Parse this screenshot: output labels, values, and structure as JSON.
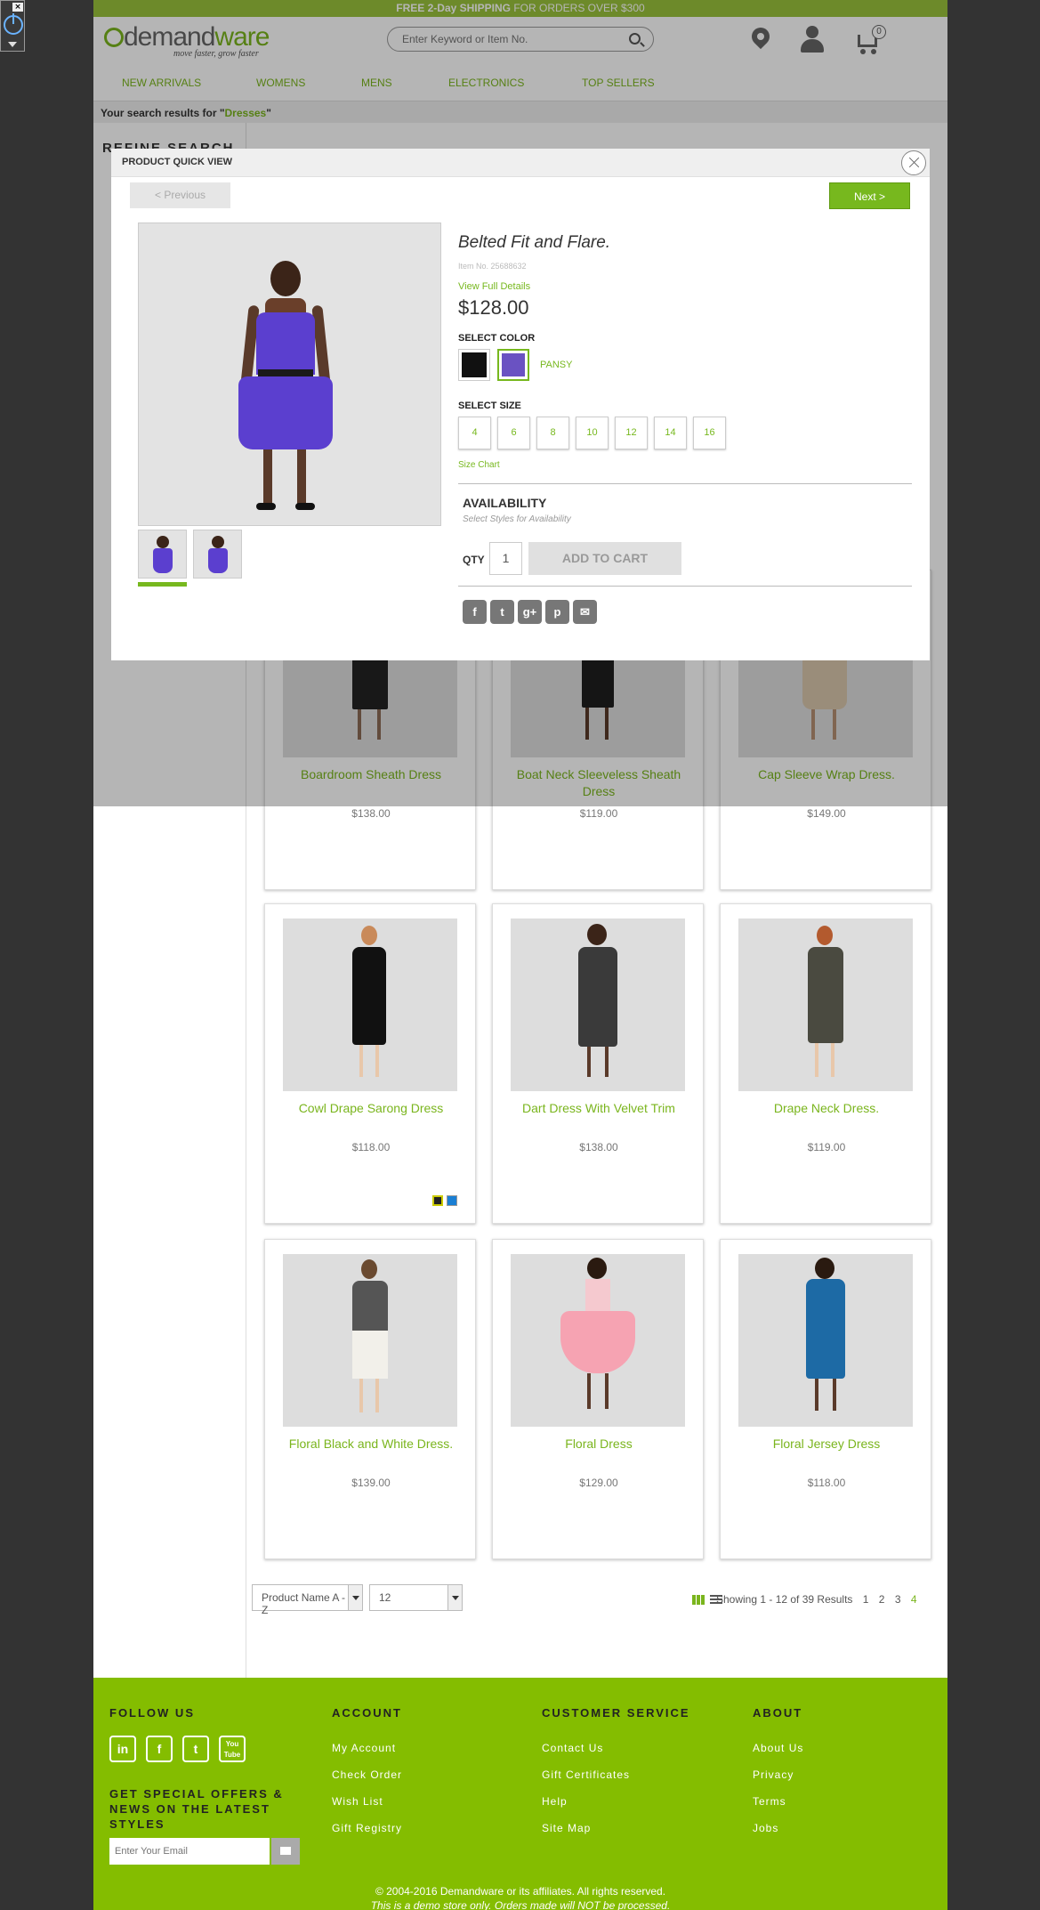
{
  "promo": {
    "bold": "FREE 2-Day SHIPPING",
    "rest": " FOR ORDERS OVER $300"
  },
  "logo": {
    "word_a": "demand",
    "word_b": "ware",
    "tagline": "move faster, grow faster"
  },
  "search": {
    "placeholder": "Enter Keyword or Item No."
  },
  "cart": {
    "count": "0"
  },
  "nav": [
    "NEW ARRIVALS",
    "WOMENS",
    "MENS",
    "ELECTRONICS",
    "TOP SELLERS"
  ],
  "results": {
    "prefix": "Your search results for \"",
    "query": "Dresses",
    "suffix": "\""
  },
  "refine": {
    "title": "REFINE SEARCH"
  },
  "products": [
    {
      "name": "Boardroom Sheath Dress",
      "price": "$138.00"
    },
    {
      "name": "Boat Neck Sleeveless Sheath Dress",
      "price": "$119.00"
    },
    {
      "name": "Cap Sleeve Wrap Dress.",
      "price": "$149.00"
    },
    {
      "name": "Cowl Drape Sarong Dress",
      "price": "$118.00",
      "swatches": [
        "#222222",
        "#1a7fd4"
      ]
    },
    {
      "name": "Dart Dress With Velvet Trim",
      "price": "$138.00"
    },
    {
      "name": "Drape Neck Dress.",
      "price": "$119.00"
    },
    {
      "name": "Floral Black and White Dress.",
      "price": "$139.00"
    },
    {
      "name": "Floral Dress",
      "price": "$129.00"
    },
    {
      "name": "Floral Jersey Dress",
      "price": "$118.00"
    }
  ],
  "toolbar": {
    "sort": "Product Name A - Z",
    "per_page": "12",
    "showing": "Showing 1 - 12 of 39 Results",
    "pages": [
      "1",
      "2",
      "3",
      "4"
    ]
  },
  "footer": {
    "follow": "FOLLOW US",
    "social": [
      "in",
      "f",
      "t",
      "You Tube"
    ],
    "offers": "GET SPECIAL OFFERS & NEWS ON THE LATEST STYLES",
    "email_placeholder": "Enter Your Email",
    "account": {
      "title": "ACCOUNT",
      "links": [
        "My Account",
        "Check Order",
        "Wish List",
        "Gift Registry"
      ]
    },
    "service": {
      "title": "CUSTOMER SERVICE",
      "links": [
        "Contact Us",
        "Gift Certificates",
        "Help",
        "Site Map"
      ]
    },
    "about": {
      "title": "ABOUT",
      "links": [
        "About Us",
        "Privacy",
        "Terms",
        "Jobs"
      ]
    },
    "copyright": "© 2004-2016 Demandware or its affiliates. All rights reserved.",
    "demo": "This is a demo store only. Orders made will NOT be processed."
  },
  "quickview": {
    "header": "PRODUCT QUICK VIEW",
    "prev": "< Previous",
    "next": "Next >",
    "title": "Belted Fit and Flare.",
    "item_no": "Item No. 25688632",
    "view_full": "View Full Details",
    "price": "$128.00",
    "select_color": "SELECT COLOR",
    "colors": [
      {
        "name": "black",
        "hex": "#111111"
      },
      {
        "name": "PANSY",
        "hex": "#6a52c2"
      }
    ],
    "selected_color": "PANSY",
    "select_size": "SELECT SIZE",
    "sizes": [
      "4",
      "6",
      "8",
      "10",
      "12",
      "14",
      "16"
    ],
    "size_chart": "Size Chart",
    "availability": "AVAILABILITY",
    "availability_note": "Select Styles for Availability",
    "qty_label": "QTY",
    "qty": "1",
    "add_to_cart": "ADD TO CART"
  }
}
